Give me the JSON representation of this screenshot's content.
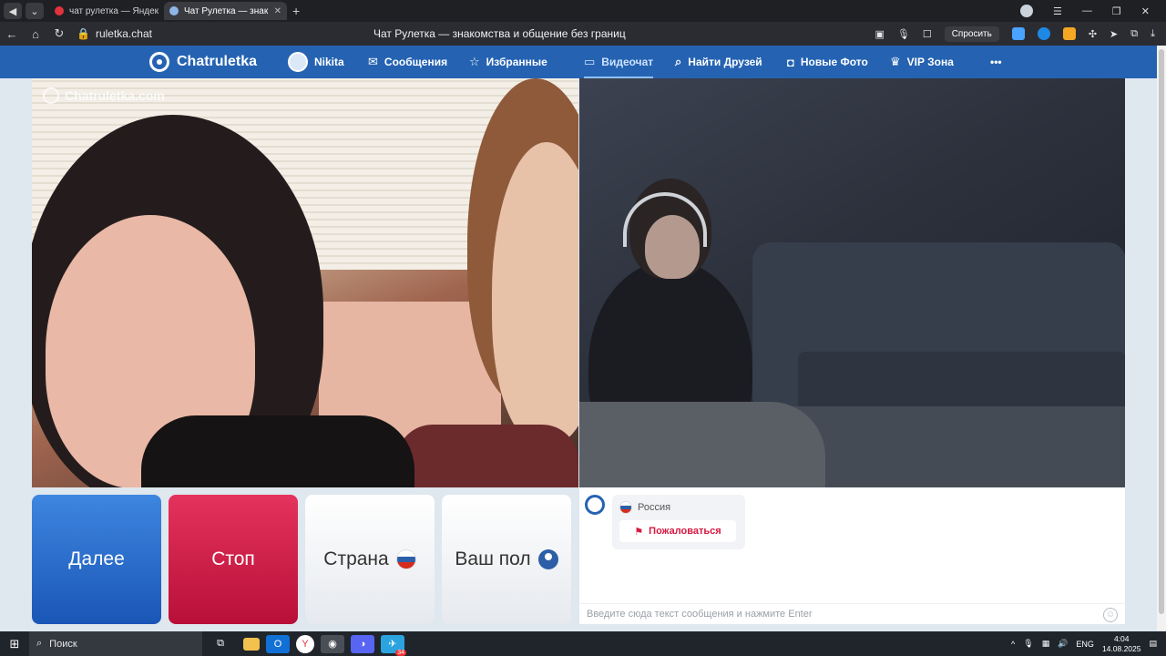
{
  "browser": {
    "tabs": [
      {
        "label": "чат рулетка — Яндекс: н",
        "favicon_color": "#e0333d",
        "active": false
      },
      {
        "label": "Чат Рулетка — знак",
        "favicon_color": "#8fb6ea",
        "active": true
      }
    ],
    "new_tab_glyph": "+",
    "address": {
      "url": "ruletka.chat",
      "page_title": "Чат Рулетка — знакомства и общение без границ"
    },
    "ask_button": "Спросить"
  },
  "site": {
    "logo_text": "Chatruletka",
    "nav": [
      {
        "label": "Nikita",
        "icon": "user-avatar-icon"
      },
      {
        "label": "Сообщения",
        "icon": "envelope-icon"
      },
      {
        "label": "Избранные",
        "icon": "star-icon"
      },
      {
        "label": "Видеочат",
        "icon": "video-camera-icon",
        "active": true
      },
      {
        "label": "Найти Друзей",
        "icon": "search-icon"
      },
      {
        "label": "Новые Фото",
        "icon": "camera-icon"
      },
      {
        "label": "VIP Зона",
        "icon": "crown-icon"
      },
      {
        "label": "•••",
        "icon": "more-icon"
      }
    ]
  },
  "video": {
    "watermark": "Chatruletka.com"
  },
  "controls": {
    "next_label": "Далее",
    "stop_label": "Стоп",
    "country_label": "Страна",
    "gender_label": "Ваш пол"
  },
  "chat": {
    "partner_country": "Россия",
    "report_label": "Пожаловаться",
    "input_placeholder": "Введите сюда текст сообщения и нажмите Enter"
  },
  "taskbar": {
    "search_label": "Поиск",
    "telegram_badge": "34",
    "lang": "ENG",
    "time": "4:04",
    "date": "14.08.2025"
  },
  "colors": {
    "brand": "#2563b2",
    "next": "#2a6fd0",
    "stop": "#d21f4c",
    "report": "#d6183f"
  }
}
